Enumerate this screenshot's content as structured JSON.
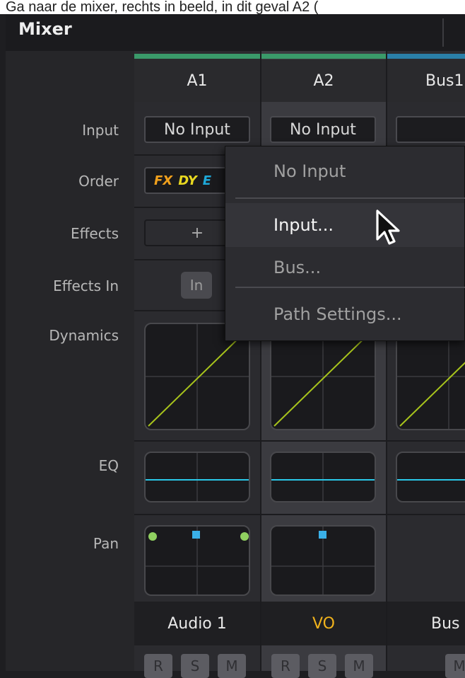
{
  "caption": "Ga naar de mixer, rechts in beeld, in dit geval A2 (",
  "header": {
    "title": "Mixer"
  },
  "row_labels": [
    "Input",
    "Order",
    "Effects",
    "Effects In",
    "Dynamics",
    "EQ",
    "Pan"
  ],
  "channels": [
    {
      "name": "A1",
      "input": "No Input",
      "order": [
        "FX",
        "DY",
        "E"
      ],
      "add_effect": "+",
      "effects_in": "In",
      "track": "Audio 1",
      "track_color": "#e8e8e8",
      "buttons": [
        "R",
        "S",
        "M"
      ],
      "bar_color": "#3a9a6a"
    },
    {
      "name": "A2",
      "input": "No Input",
      "track": "VO",
      "track_color": "#f0b21c",
      "buttons": [
        "R",
        "S",
        "M"
      ],
      "bar_color": "#3a9a6a"
    },
    {
      "name": "Bus1",
      "input": "",
      "track": "Bus",
      "track_color": "#e8e8e8",
      "buttons": [
        "M"
      ],
      "bar_color": "#2a7fa8"
    }
  ],
  "order_colors": {
    "FX": "#f0a01c",
    "DY": "#e8d820",
    "E": "#1ea8d8"
  },
  "curve_colors": {
    "dynamics": "#a8c41c",
    "eq": "#2ac8e8",
    "pan_green": "#90d060",
    "pan_blue": "#3ab0e8"
  },
  "menu": {
    "items": [
      "No Input",
      "Input...",
      "Bus...",
      "Path Settings..."
    ],
    "hovered": "Input..."
  },
  "icons": {
    "cursor": "arrow-cursor-icon",
    "add": "plus-icon"
  }
}
